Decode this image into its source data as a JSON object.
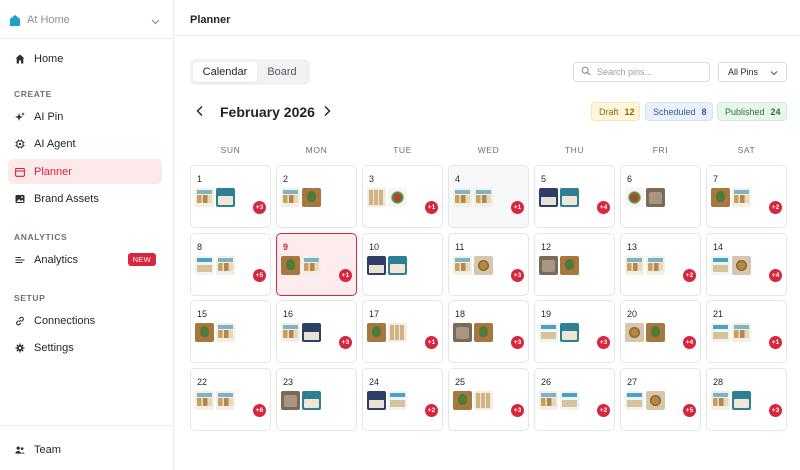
{
  "workspace": {
    "name": "At Home"
  },
  "sidebar": {
    "home": "Home",
    "sections": {
      "create": "CREATE",
      "analytics": "ANALYTICS",
      "setup": "SETUP"
    },
    "items": {
      "ai_pin": "AI Pin",
      "ai_agent": "AI Agent",
      "planner": "Planner",
      "brand_assets": "Brand Assets",
      "analytics": "Analytics",
      "analytics_badge": "NEW",
      "connections": "Connections",
      "settings": "Settings"
    },
    "team": "Team"
  },
  "header": {
    "title": "Planner"
  },
  "view_toggle": {
    "calendar": "Calendar",
    "board": "Board"
  },
  "search": {
    "placeholder": "Search pins..."
  },
  "filter": {
    "selected": "All Pins"
  },
  "month": {
    "title": "February 2026"
  },
  "status": {
    "draft_label": "Draft",
    "draft_count": "12",
    "scheduled_label": "Scheduled",
    "scheduled_count": "8",
    "published_label": "Published",
    "published_count": "24"
  },
  "weekdays": [
    "SUN",
    "MON",
    "TUE",
    "WED",
    "THU",
    "FRI",
    "SAT"
  ],
  "days": [
    {
      "day": "1",
      "thumbs": [
        "food",
        "teal"
      ],
      "more": "+3"
    },
    {
      "day": "2",
      "thumbs": [
        "food",
        "plant"
      ],
      "more": ""
    },
    {
      "day": "3",
      "thumbs": [
        "grid",
        "salad"
      ],
      "more": "+1"
    },
    {
      "day": "4",
      "thumbs": [
        "food",
        "food"
      ],
      "more": "+1",
      "shaded": true
    },
    {
      "day": "5",
      "thumbs": [
        "navy",
        "teal"
      ],
      "more": "+4"
    },
    {
      "day": "6",
      "thumbs": [
        "salad",
        "wood"
      ],
      "more": ""
    },
    {
      "day": "7",
      "thumbs": [
        "plant",
        "food"
      ],
      "more": "+2"
    },
    {
      "day": "8",
      "thumbs": [
        "bright",
        "food"
      ],
      "more": "+5"
    },
    {
      "day": "9",
      "thumbs": [
        "plant",
        "food"
      ],
      "more": "+1",
      "today": true
    },
    {
      "day": "10",
      "thumbs": [
        "navy",
        "teal"
      ],
      "more": ""
    },
    {
      "day": "11",
      "thumbs": [
        "food",
        "pot"
      ],
      "more": "+3"
    },
    {
      "day": "12",
      "thumbs": [
        "wood",
        "plant"
      ],
      "more": ""
    },
    {
      "day": "13",
      "thumbs": [
        "food",
        "food"
      ],
      "more": "+2"
    },
    {
      "day": "14",
      "thumbs": [
        "bright",
        "pot"
      ],
      "more": "+4"
    },
    {
      "day": "15",
      "thumbs": [
        "plant",
        "food"
      ],
      "more": ""
    },
    {
      "day": "16",
      "thumbs": [
        "food",
        "navy"
      ],
      "more": "+3"
    },
    {
      "day": "17",
      "thumbs": [
        "plant",
        "grid"
      ],
      "more": "+1"
    },
    {
      "day": "18",
      "thumbs": [
        "wood",
        "plant"
      ],
      "more": "+3"
    },
    {
      "day": "19",
      "thumbs": [
        "bright",
        "teal"
      ],
      "more": "+3"
    },
    {
      "day": "20",
      "thumbs": [
        "pot",
        "plant"
      ],
      "more": "+4"
    },
    {
      "day": "21",
      "thumbs": [
        "bright",
        "food"
      ],
      "more": "+1"
    },
    {
      "day": "22",
      "thumbs": [
        "food",
        "food"
      ],
      "more": "+6"
    },
    {
      "day": "23",
      "thumbs": [
        "wood",
        "teal"
      ],
      "more": ""
    },
    {
      "day": "24",
      "thumbs": [
        "navy",
        "bright"
      ],
      "more": "+2"
    },
    {
      "day": "25",
      "thumbs": [
        "plant",
        "grid"
      ],
      "more": "+3"
    },
    {
      "day": "26",
      "thumbs": [
        "food",
        "bright"
      ],
      "more": "+2"
    },
    {
      "day": "27",
      "thumbs": [
        "bright",
        "pot"
      ],
      "more": "+5"
    },
    {
      "day": "28",
      "thumbs": [
        "food",
        "teal"
      ],
      "more": "+3"
    }
  ],
  "colors": {
    "accent": "#d7263d",
    "active_bg": "#fde8ea"
  },
  "icons": {
    "workspace": "house-icon",
    "home": "home-icon",
    "ai_pin": "sparkle-icon",
    "ai_agent": "chip-icon",
    "planner": "calendar-icon",
    "brand_assets": "image-icon",
    "analytics": "chart-lines-icon",
    "connections": "link-icon",
    "settings": "gear-icon",
    "team": "users-icon",
    "search": "search-icon"
  }
}
